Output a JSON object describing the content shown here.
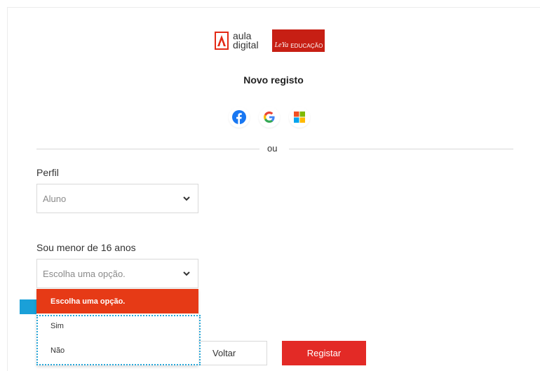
{
  "brand": {
    "aula_line1": "aula",
    "aula_line2": "digital",
    "leya": "LeYa",
    "educacao": "EDUCAÇÃO"
  },
  "title": "Novo registo",
  "social": [
    {
      "name": "facebook-icon",
      "color": "#1877f2"
    },
    {
      "name": "google-icon",
      "color": "#4285f4"
    },
    {
      "name": "microsoft-icon",
      "color": "#f25022"
    }
  ],
  "divider_text": "ou",
  "perfil": {
    "label": "Perfil",
    "value": "Aluno"
  },
  "age": {
    "label": "Sou menor de 16 anos",
    "value": "Escolha uma opção.",
    "options": [
      "Escolha uma opção.",
      "Sim",
      "Não"
    ]
  },
  "actions": {
    "back": "Voltar",
    "register": "Registar"
  },
  "colors": {
    "accent": "#e32a26",
    "selected_option": "#e63a16",
    "focus": "#28a7d8"
  }
}
